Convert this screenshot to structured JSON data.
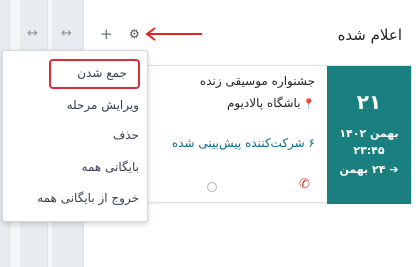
{
  "column": {
    "title": "اعلام شده",
    "add_icon": "+",
    "settings_icon": "⚙"
  },
  "folded_columns": {
    "expand_icon_1": "↔",
    "expand_icon_2": "↔"
  },
  "dropdown": {
    "items": [
      "جمع شدن",
      "ویرایش مرحله",
      "حذف",
      "بایگانی همه",
      "خروج از بایگانی همه"
    ],
    "highlighted_index": 0
  },
  "card": {
    "day": "۲۱",
    "month_year": "بهمن ۱۴۰۲",
    "time": "۲۳:۴۵",
    "end_date": "➔ ۲۴ بهمن",
    "title": "جشنواره موسیقی زنده",
    "venue": "باشگاه پالادیوم",
    "venue_icon": "map-marker-icon",
    "attendees": "۶ شرکت‌کننده پیش‌بینی شده",
    "phone_icon": "phone-icon"
  },
  "colors": {
    "date_block": "#1a7f7f",
    "highlight": "#d92d3a",
    "arrow": "#e02424",
    "attendees_text": "#0a6e8a",
    "phone": "#d33a3a"
  }
}
